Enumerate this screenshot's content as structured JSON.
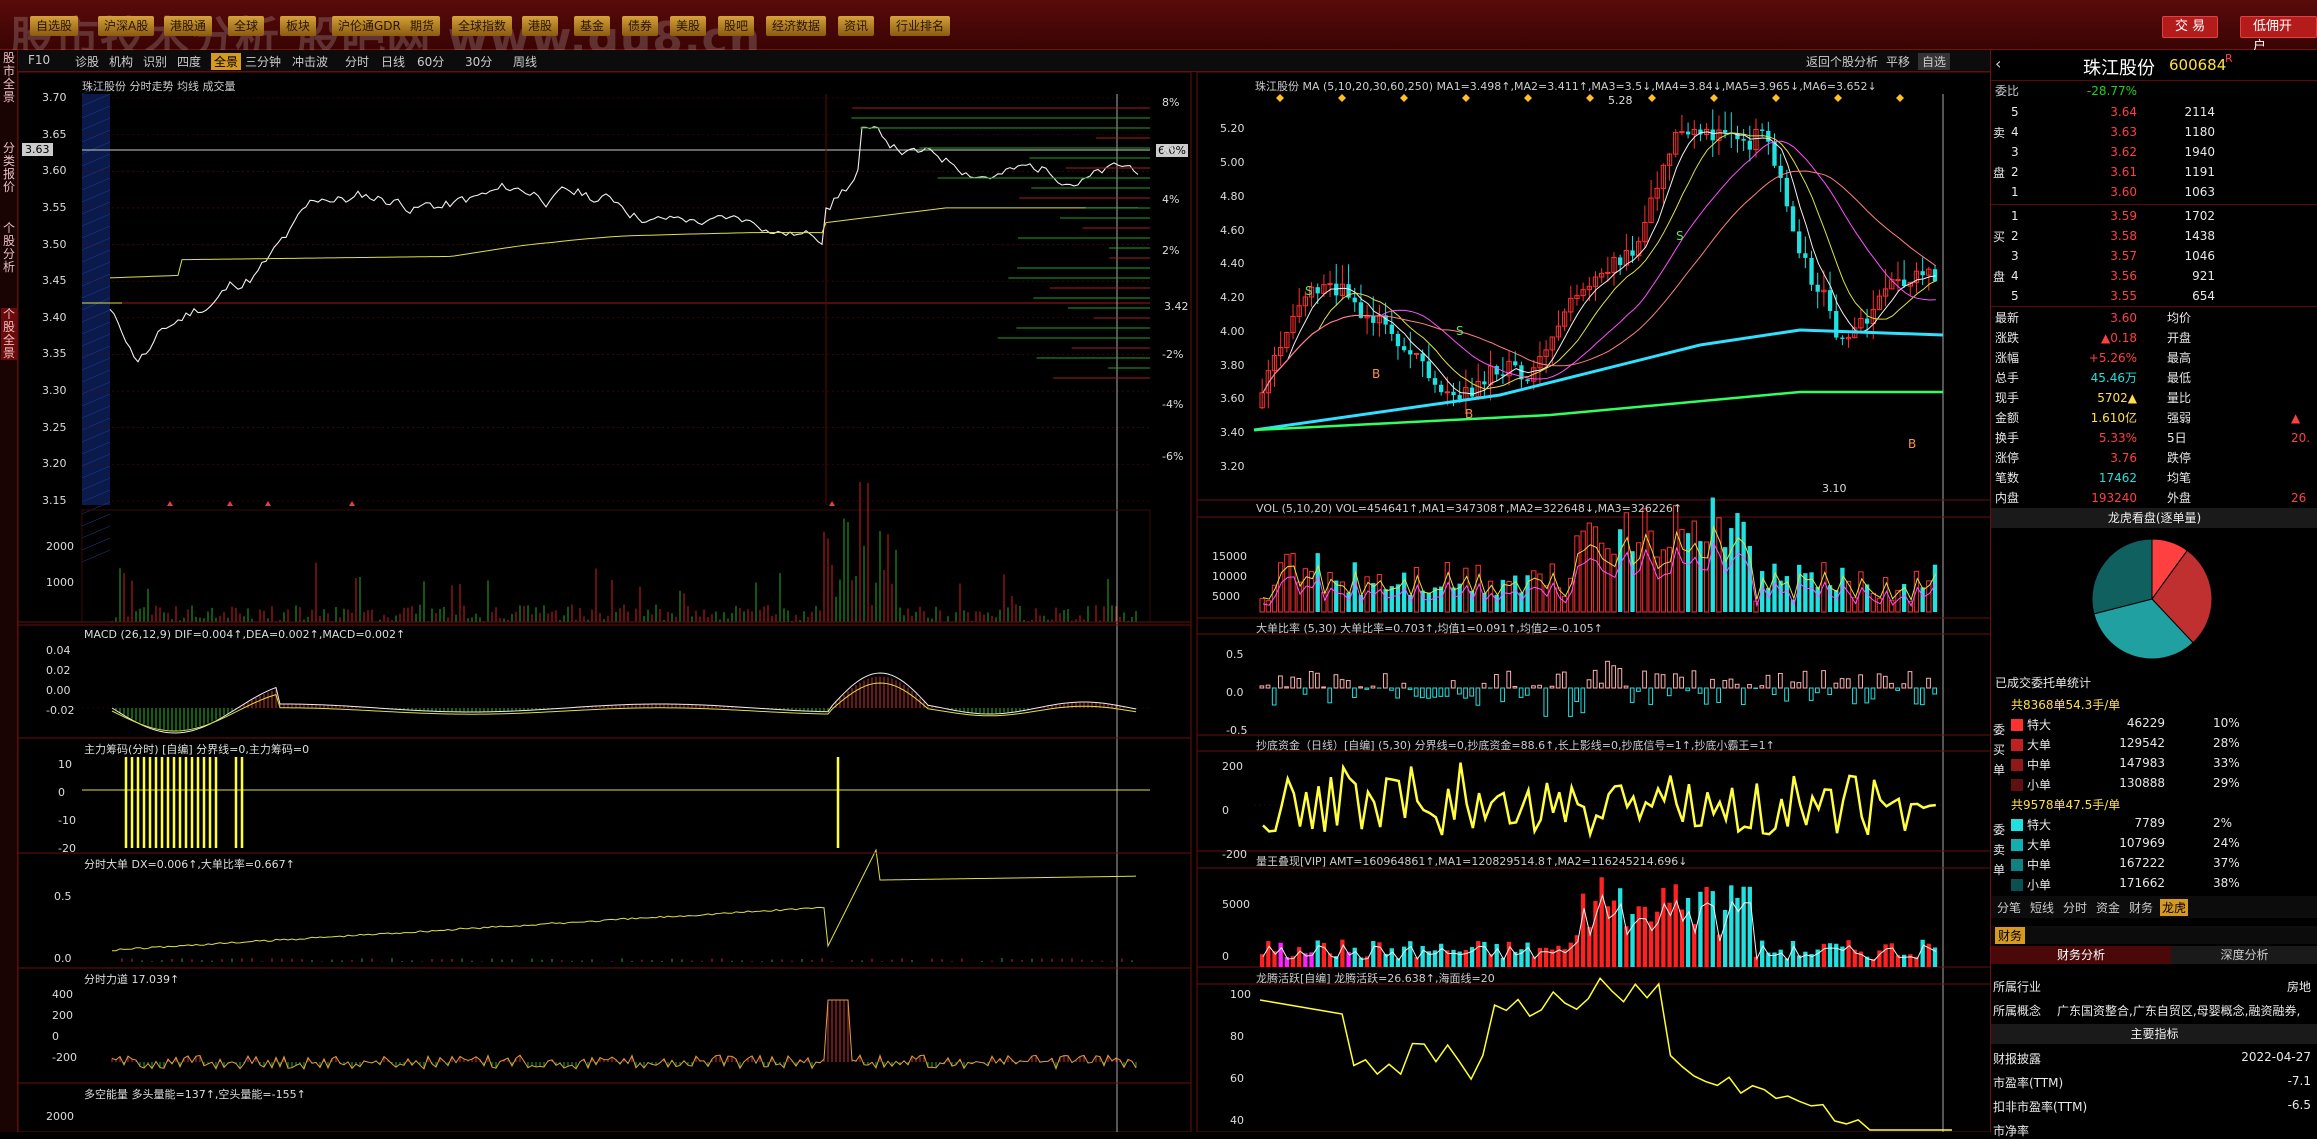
{
  "topbar": {
    "watermark": "股市技术分析 股吧网 www.gu8.cn",
    "buttons": [
      "自选股",
      "沪深A股",
      "港股通",
      "全球",
      "板块",
      "沪伦通GDR",
      "期货",
      "全球指数",
      "港股",
      "基金",
      "债券",
      "美股",
      "股吧",
      "经济数据",
      "资讯",
      "行业排名"
    ],
    "trade_label": "交 易",
    "open_account_label": "低佣开户"
  },
  "left_tabs": [
    "股市全景",
    "分类报价",
    "个股分析",
    "个股全景"
  ],
  "toolbar": {
    "left": [
      "F10",
      "诊股",
      "机构",
      "识别",
      "四度",
      "全景",
      "三分钟",
      "冲击波"
    ],
    "periods": [
      "分时",
      "日线",
      "60分",
      "30分",
      "周线"
    ],
    "right": [
      "返回个股分析",
      "平移",
      "自选"
    ]
  },
  "intraday": {
    "header": "珠江股份  分时走势  均线  成交量",
    "price_ticks": [
      "3.70",
      "3.65",
      "3.60",
      "3.55",
      "3.50",
      "3.45",
      "3.40",
      "3.35",
      "3.30",
      "3.25",
      "3.20",
      "3.15"
    ],
    "current_price": "3.63",
    "pct_ticks": [
      "8%",
      "6%",
      "4%",
      "2%",
      "-2%",
      "-4%",
      "-6%"
    ],
    "pct_label": "6.0%",
    "ref_price": "3.42",
    "vol_ticks": [
      "2000",
      "1000"
    ],
    "macd_header": "MACD  (26,12,9)  DIF=0.004↑,DEA=0.002↑,MACD=0.002↑",
    "macd_ticks": [
      "0.04",
      "0.02",
      "0.00",
      "-0.02"
    ],
    "zlcm_header": "主力筹码(分时)  [自编]  分界线=0,主力筹码=0",
    "zlcm_ticks": [
      "10",
      "0",
      "-10",
      "-20"
    ],
    "fsdd_header": "分时大单  DX=0.006↑,大单比率=0.667↑",
    "fsdd_ticks": [
      "0.5",
      "0.0"
    ],
    "fsld_header": "分时力道  17.039↑",
    "fsld_ticks": [
      "400",
      "200",
      "0",
      "-200"
    ],
    "dkn_header": "多空能量  多头量能=137↑,空头量能=-155↑",
    "dkn_ticks": [
      "2000"
    ]
  },
  "kline": {
    "header": "珠江股份  MA  (5,10,20,30,60,250)  MA1=3.498↑,MA2=3.411↑,MA3=3.5↓,MA4=3.84↓,MA5=3.965↓,MA6=3.652↓",
    "price_ticks": [
      "5.20",
      "5.00",
      "4.80",
      "4.60",
      "4.40",
      "4.20",
      "4.00",
      "3.80",
      "3.60",
      "3.40",
      "3.20"
    ],
    "high_label": "5.28",
    "low_label": "3.10",
    "vol_header": "VOL  (5,10,20)  VOL=454641↑,MA1=347308↑,MA2=322648↓,MA3=326226↑",
    "vol_ticks": [
      "15000",
      "10000",
      "5000"
    ],
    "ddbl_header": "大单比率  (5,30)  大单比率=0.703↑,均值1=0.091↑,均值2=-0.105↑",
    "ddbl_ticks": [
      "0.5",
      "0.0",
      "-0.5"
    ],
    "cdzj_header": "抄底资金（日线）[自编]  (5,30)  分界线=0,抄底资金=88.6↑,长上影线=0,抄底信号=1↑,抄底小霸王=1↑",
    "cdzj_ticks": [
      "200",
      "0",
      "-200"
    ],
    "lwdx_header": "量王叠现[VIP]  AMT=160964861↑,MA1=120829514.8↑,MA2=116245214.696↓",
    "lwdx_ticks": [
      "5000",
      "0"
    ],
    "lthy_header": "龙腾活跃[自编]  龙腾活跃=26.638↑,海面线=20",
    "lthy_ticks": [
      "100",
      "80",
      "60",
      "40"
    ]
  },
  "quote": {
    "name": "珠江股份",
    "code": "600684",
    "badge": "R",
    "weibi_label": "委比",
    "weibi_value": "-28.77%",
    "sell": [
      {
        "lv": "5",
        "p": "3.64",
        "v": "2114"
      },
      {
        "lv": "4",
        "p": "3.63",
        "v": "1180"
      },
      {
        "lv": "3",
        "p": "3.62",
        "v": "1940"
      },
      {
        "lv": "2",
        "p": "3.61",
        "v": "1191"
      },
      {
        "lv": "1",
        "p": "3.60",
        "v": "1063"
      }
    ],
    "sell_side_label": "卖",
    "sell_side_label2": "盘",
    "buy": [
      {
        "lv": "1",
        "p": "3.59",
        "v": "1702"
      },
      {
        "lv": "2",
        "p": "3.58",
        "v": "1438"
      },
      {
        "lv": "3",
        "p": "3.57",
        "v": "1046"
      },
      {
        "lv": "4",
        "p": "3.56",
        "v": "921"
      },
      {
        "lv": "5",
        "p": "3.55",
        "v": "654"
      }
    ],
    "buy_side_label": "买",
    "buy_side_label2": "盘",
    "stats": [
      {
        "k": "最新",
        "v": "3.60",
        "k2": "均价",
        "v2": ""
      },
      {
        "k": "涨跌",
        "v": "▲0.18",
        "k2": "开盘",
        "v2": ""
      },
      {
        "k": "涨幅",
        "v": "+5.26%",
        "k2": "最高",
        "v2": ""
      },
      {
        "k": "总手",
        "v": "45.46万",
        "k2": "最低",
        "v2": ""
      },
      {
        "k": "现手",
        "v": "5702▲",
        "k2": "量比",
        "v2": ""
      },
      {
        "k": "金额",
        "v": "1.610亿",
        "k2": "强弱",
        "v2": "▲"
      },
      {
        "k": "换手",
        "v": "5.33%",
        "k2": "5日",
        "v2": "20."
      },
      {
        "k": "涨停",
        "v": "3.76",
        "k2": "跌停",
        "v2": ""
      },
      {
        "k": "笔数",
        "v": "17462",
        "k2": "均笔",
        "v2": ""
      },
      {
        "k": "内盘",
        "v": "193240",
        "k2": "外盘",
        "v2": "26"
      }
    ],
    "pie_title": "龙虎看盘(逐单量)",
    "pie_slices": [
      {
        "share": 10,
        "color": "#ff4040"
      },
      {
        "share": 28,
        "color": "#c03030"
      },
      {
        "share": 33,
        "color": "#20a0a0"
      },
      {
        "share": 29,
        "color": "#106060"
      }
    ],
    "order_stat_title": "已成交委托单统计",
    "buy_total": "共8368单54.3手/单",
    "buy_orders": [
      {
        "k": "特大",
        "v": "46229",
        "p": "10%",
        "color": "#ff3030"
      },
      {
        "k": "大单",
        "v": "129542",
        "p": "28%",
        "color": "#c02020"
      },
      {
        "k": "中单",
        "v": "147983",
        "p": "33%",
        "color": "#901818"
      },
      {
        "k": "小单",
        "v": "130888",
        "p": "29%",
        "color": "#601010"
      }
    ],
    "buy_side": "委买单",
    "sell_total": "共9578单47.5手/单",
    "sell_orders": [
      {
        "k": "特大",
        "v": "7789",
        "p": "2%",
        "color": "#20e0e0"
      },
      {
        "k": "大单",
        "v": "107969",
        "p": "24%",
        "color": "#10b0b0"
      },
      {
        "k": "中单",
        "v": "167222",
        "p": "37%",
        "color": "#108080"
      },
      {
        "k": "小单",
        "v": "171662",
        "p": "38%",
        "color": "#0a5050"
      }
    ],
    "sell_side": "委卖单",
    "tabs": [
      "分笔",
      "短线",
      "分时",
      "资金",
      "财务",
      "龙虎"
    ],
    "fin_tab": "财务",
    "fin_sub": [
      "财务分析",
      "深度分析"
    ],
    "industry_k": "所属行业",
    "industry_v": "房地",
    "concept_k": "所属概念",
    "concept_v": "广东国资整合,广东自贸区,母婴概念,融资融券,",
    "main_idx": "主要指标",
    "fin_rows": [
      {
        "k": "财报披露",
        "v": "2022-04-27"
      },
      {
        "k": "市盈率(TTM)",
        "v": "-7.1"
      },
      {
        "k": "扣非市盈率(TTM)",
        "v": "-6.5"
      },
      {
        "k": "市净率",
        "v": ""
      }
    ]
  }
}
